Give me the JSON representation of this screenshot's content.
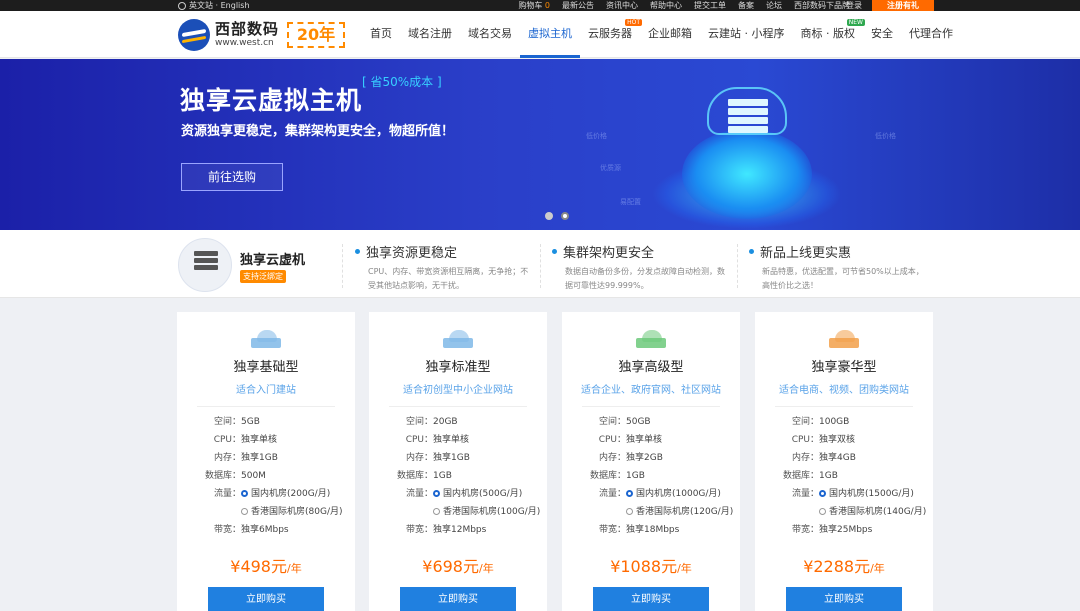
{
  "topbar": {
    "lang": "英文站 · English",
    "links": [
      "购物车",
      "0",
      "最新公告",
      "资讯中心",
      "帮助中心",
      "提交工单",
      "备案",
      "论坛",
      "西部数码下品牌"
    ],
    "login": "登录",
    "register": "注册有礼"
  },
  "header": {
    "logo_cn": "西部数码",
    "logo_en": "www.west.cn",
    "badge": "20年",
    "nav": [
      {
        "label": "首页"
      },
      {
        "label": "域名注册"
      },
      {
        "label": "域名交易"
      },
      {
        "label": "虚拟主机",
        "active": true
      },
      {
        "label": "云服务器",
        "tag": "HOT"
      },
      {
        "label": "企业邮箱"
      },
      {
        "label": "云建站 · 小程序"
      },
      {
        "label": "商标 · 版权",
        "tag": "NEW"
      },
      {
        "label": "安全"
      },
      {
        "label": "代理合作"
      }
    ]
  },
  "banner": {
    "title": "独享云虚拟主机",
    "save": "[ 省50%成本 ]",
    "subtitle": "资源独享更稳定，集群架构更安全，物超所值！",
    "cta": "前往选购",
    "ghost": [
      "低价格",
      "优质源",
      "易配置",
      "低价格"
    ]
  },
  "features": {
    "product": "独享云虚机",
    "product_tag": "支持泛绑定",
    "items": [
      {
        "title": "独享资源更稳定",
        "desc": "CPU、内存、带宽资源相互隔离，无争抢；不受其他站点影响，无干扰。"
      },
      {
        "title": "集群架构更安全",
        "desc": "数据自动备份多份，分发点故障自动检测，数据可靠性达99.999%。"
      },
      {
        "title": "新品上线更实惠",
        "desc": "新品特惠，优选配置，可节省50%以上成本，高性价比之选！"
      }
    ]
  },
  "labels": {
    "space": "空间：",
    "cpu": "CPU：",
    "mem": "内存：",
    "db": "数据库：",
    "traffic": "流量：",
    "bandwidth": "带宽：",
    "buy": "立即购买"
  },
  "cards": [
    {
      "name": "独享基础型",
      "fit": "适合入门建站",
      "space": "5GB",
      "cpu": "独享单核",
      "mem": "独享1GB",
      "db": "500M",
      "t1": "国内机房(200G/月)",
      "t2": "香港国际机房(80G/月)",
      "bw": "独享6Mbps",
      "price": "¥498元",
      "unit": "/年",
      "color": "#7fb8e8"
    },
    {
      "name": "独享标准型",
      "fit": "适合初创型中小企业网站",
      "space": "20GB",
      "cpu": "独享单核",
      "mem": "独享1GB",
      "db": "1GB",
      "t1": "国内机房(500G/月)",
      "t2": "香港国际机房(100G/月)",
      "bw": "独享12Mbps",
      "price": "¥698元",
      "unit": "/年",
      "color": "#7fb8e8"
    },
    {
      "name": "独享高级型",
      "fit": "适合企业、政府官网、社区网站",
      "space": "50GB",
      "cpu": "独享单核",
      "mem": "独享2GB",
      "db": "1GB",
      "t1": "国内机房(1000G/月)",
      "t2": "香港国际机房(120G/月)",
      "bw": "独享18Mbps",
      "price": "¥1088元",
      "unit": "/年",
      "color": "#6cc97a"
    },
    {
      "name": "独享豪华型",
      "fit": "适合电商、视频、团购类网站",
      "space": "100GB",
      "cpu": "独享双核",
      "mem": "独享4GB",
      "db": "1GB",
      "t1": "国内机房(1500G/月)",
      "t2": "香港国际机房(140G/月)",
      "bw": "独享25Mbps",
      "price": "¥2288元",
      "unit": "/年",
      "color": "#f2a04a"
    }
  ]
}
